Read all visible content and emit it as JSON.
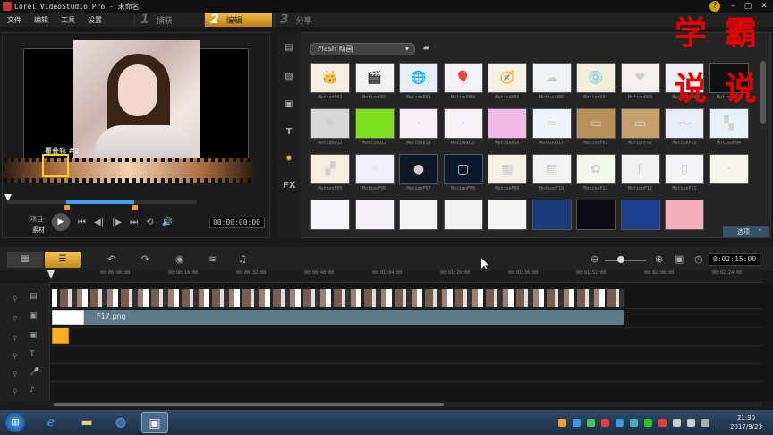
{
  "window": {
    "title": "Corel VideoStudio Pro - 未命名",
    "controls": [
      "–",
      "▢",
      "✕"
    ],
    "help": "?"
  },
  "menu": [
    "文件",
    "编辑",
    "工具",
    "设置"
  ],
  "steps": [
    {
      "num": "1",
      "label": "捕获"
    },
    {
      "num": "2",
      "label": "编辑"
    },
    {
      "num": "3",
      "label": "分享"
    }
  ],
  "preview": {
    "overlay_label": "覆叠轨 #2",
    "timecode": "00:00:00:00",
    "mode_project": "项目-",
    "mode_clip": "素材",
    "controls": [
      "▶",
      "⏮",
      "◀|",
      "|▶",
      "⏭",
      "⟲",
      "🔊"
    ]
  },
  "library": {
    "dropdown": "Flash 动画",
    "sidebar_icons": [
      "media-icon",
      "transition-icon",
      "title-icon",
      "text-icon",
      "flash-icon",
      "fx-icon"
    ],
    "options_label": "选项",
    "items": [
      {
        "label": "MotionD01",
        "icon": "👑",
        "bg": "#f4eee4"
      },
      {
        "label": "MotionD02",
        "icon": "🎬",
        "bg": "#f2f2f2"
      },
      {
        "label": "MotionD03",
        "icon": "🌐",
        "bg": "#e8eef8"
      },
      {
        "label": "MotionD04",
        "icon": "🎈",
        "bg": "#f4f4f8"
      },
      {
        "label": "MotionD05",
        "icon": "🧭",
        "bg": "#f4f0e4"
      },
      {
        "label": "MotionD06",
        "icon": "☁",
        "bg": "#eef2f6"
      },
      {
        "label": "MotionD07",
        "icon": "💿",
        "bg": "#f2eedc"
      },
      {
        "label": "MotionD08",
        "icon": "❤",
        "bg": "#f6f0f0"
      },
      {
        "label": "MotionD09",
        "icon": "✦",
        "bg": "#f0eef2"
      },
      {
        "label": "MotionD11",
        "icon": "",
        "bg": "#111111"
      },
      {
        "label": "MotionD12",
        "icon": "✺",
        "bg": "#d8d8d8"
      },
      {
        "label": "MotionD13",
        "icon": "",
        "bg": "#7fe020"
      },
      {
        "label": "MotionD14",
        "icon": "·",
        "bg": "#f6f0f6"
      },
      {
        "label": "MotionD15",
        "icon": "·",
        "bg": "#f8f2f6"
      },
      {
        "label": "MotionD16",
        "icon": "♡",
        "bg": "#f2b8e6"
      },
      {
        "label": "MotionD17",
        "icon": "≈",
        "bg": "#eef4fa"
      },
      {
        "label": "MotionF01",
        "icon": "▭",
        "bg": "#b8905a"
      },
      {
        "label": "MotionF02",
        "icon": "▭",
        "bg": "#c8a070"
      },
      {
        "label": "MotionF03",
        "icon": "～",
        "bg": "#e8ecf6"
      },
      {
        "label": "MotionF04",
        "icon": "▚",
        "bg": "#e8f0f8"
      },
      {
        "label": "MotionF05",
        "icon": "▞",
        "bg": "#f4eee0"
      },
      {
        "label": "MotionF06",
        "icon": "◦",
        "bg": "#f0eef6"
      },
      {
        "label": "MotionF07",
        "icon": "●",
        "bg": "#101828"
      },
      {
        "label": "MotionF08",
        "icon": "▢",
        "bg": "#0c1830"
      },
      {
        "label": "MotionF09",
        "icon": "▦",
        "bg": "#f4f0e6"
      },
      {
        "label": "MotionF10",
        "icon": "▤",
        "bg": "#f2f2f4"
      },
      {
        "label": "MotionF11",
        "icon": "✿",
        "bg": "#f4f6f0"
      },
      {
        "label": "MotionF12",
        "icon": "∥",
        "bg": "#f2f2f2"
      },
      {
        "label": "MotionF13",
        "icon": "▯",
        "bg": "#f4f4f6"
      },
      {
        "label": "",
        "icon": "·",
        "bg": "#f6f6ee"
      },
      {
        "label": "",
        "icon": "",
        "bg": "#f6f6f8"
      },
      {
        "label": "",
        "icon": "",
        "bg": "#f4f2f6"
      },
      {
        "label": "",
        "icon": "",
        "bg": "#f4f4f4"
      },
      {
        "label": "",
        "icon": "",
        "bg": "#f2f2f2"
      },
      {
        "label": "",
        "icon": "",
        "bg": "#f4f4f2"
      },
      {
        "label": "",
        "icon": "",
        "bg": "#1a3a7a"
      },
      {
        "label": "",
        "icon": "",
        "bg": "#0a0a10"
      },
      {
        "label": "",
        "icon": "",
        "bg": "#1c3c8c"
      },
      {
        "label": "",
        "icon": "",
        "bg": "#f4b0c0"
      }
    ]
  },
  "watermark": [
    "学",
    "霸",
    "说",
    "说"
  ],
  "timeline": {
    "timecode": "0:02:15:00",
    "ruler": [
      "00:00:00:00",
      "00:00:16:00",
      "00:00:32:00",
      "00:00:48:00",
      "00:01:04:00",
      "00:01:20:00",
      "00:01:36:00",
      "00:01:52:00",
      "00:02:08:00",
      "00:02:24:00",
      "00:02:40:00"
    ],
    "overlay_clip_name": "F17.png"
  },
  "taskbar": {
    "time": "21:30",
    "date": "2017/9/23"
  },
  "colors": {
    "accent": "#f0b030",
    "watermark": "#e80000"
  }
}
